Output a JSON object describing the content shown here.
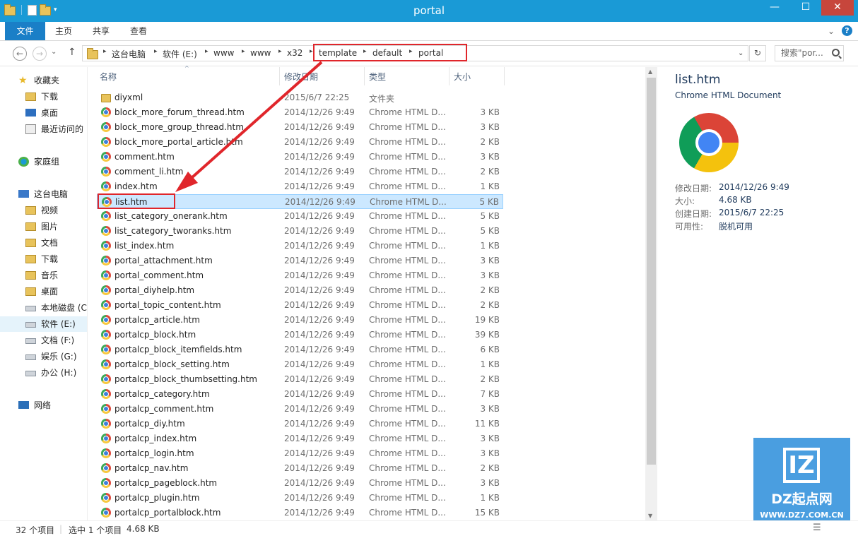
{
  "window": {
    "title": "portal"
  },
  "ribbon": {
    "tabs": [
      "文件",
      "主页",
      "共享",
      "查看"
    ],
    "help": "?"
  },
  "nav": {
    "back": "←",
    "forward": "→",
    "up": "↑",
    "breadcrumbs": [
      "这台电脑",
      "软件 (E:)",
      "www",
      "www",
      "x32",
      "template",
      "default",
      "portal"
    ],
    "search_placeholder": "搜索\"por...",
    "refresh": "↻"
  },
  "sidebar": {
    "items": [
      {
        "label": "收藏夹",
        "icon": "star-icon"
      },
      {
        "label": "下载",
        "icon": "folder-icon"
      },
      {
        "label": "桌面",
        "icon": "desktop-icon"
      },
      {
        "label": "最近访问的",
        "icon": "recent-icon"
      },
      {
        "label": "家庭组",
        "icon": "homegroup-icon"
      },
      {
        "label": "这台电脑",
        "icon": "computer-icon"
      },
      {
        "label": "视频",
        "icon": "folder-icon"
      },
      {
        "label": "图片",
        "icon": "folder-icon"
      },
      {
        "label": "文档",
        "icon": "folder-icon"
      },
      {
        "label": "下载",
        "icon": "folder-icon"
      },
      {
        "label": "音乐",
        "icon": "folder-icon"
      },
      {
        "label": "桌面",
        "icon": "folder-icon"
      },
      {
        "label": "本地磁盘 (C",
        "icon": "drive-icon"
      },
      {
        "label": "软件 (E:)",
        "icon": "drive-icon"
      },
      {
        "label": "文档 (F:)",
        "icon": "drive-icon"
      },
      {
        "label": "娱乐 (G:)",
        "icon": "drive-icon"
      },
      {
        "label": "办公 (H:)",
        "icon": "drive-icon"
      },
      {
        "label": "网络",
        "icon": "network-icon"
      }
    ]
  },
  "columns": {
    "name": "名称",
    "date": "修改日期",
    "type": "类型",
    "size": "大小"
  },
  "files": [
    {
      "name": "diyxml",
      "date": "2015/6/7 22:25",
      "type": "文件夹",
      "size": "",
      "folder": true
    },
    {
      "name": "block_more_forum_thread.htm",
      "date": "2014/12/26 9:49",
      "type": "Chrome HTML D...",
      "size": "3 KB"
    },
    {
      "name": "block_more_group_thread.htm",
      "date": "2014/12/26 9:49",
      "type": "Chrome HTML D...",
      "size": "3 KB"
    },
    {
      "name": "block_more_portal_article.htm",
      "date": "2014/12/26 9:49",
      "type": "Chrome HTML D...",
      "size": "2 KB"
    },
    {
      "name": "comment.htm",
      "date": "2014/12/26 9:49",
      "type": "Chrome HTML D...",
      "size": "3 KB"
    },
    {
      "name": "comment_li.htm",
      "date": "2014/12/26 9:49",
      "type": "Chrome HTML D...",
      "size": "2 KB"
    },
    {
      "name": "index.htm",
      "date": "2014/12/26 9:49",
      "type": "Chrome HTML D...",
      "size": "1 KB"
    },
    {
      "name": "list.htm",
      "date": "2014/12/26 9:49",
      "type": "Chrome HTML D...",
      "size": "5 KB",
      "selected": true
    },
    {
      "name": "list_category_onerank.htm",
      "date": "2014/12/26 9:49",
      "type": "Chrome HTML D...",
      "size": "5 KB"
    },
    {
      "name": "list_category_tworanks.htm",
      "date": "2014/12/26 9:49",
      "type": "Chrome HTML D...",
      "size": "5 KB"
    },
    {
      "name": "list_index.htm",
      "date": "2014/12/26 9:49",
      "type": "Chrome HTML D...",
      "size": "1 KB"
    },
    {
      "name": "portal_attachment.htm",
      "date": "2014/12/26 9:49",
      "type": "Chrome HTML D...",
      "size": "3 KB"
    },
    {
      "name": "portal_comment.htm",
      "date": "2014/12/26 9:49",
      "type": "Chrome HTML D...",
      "size": "3 KB"
    },
    {
      "name": "portal_diyhelp.htm",
      "date": "2014/12/26 9:49",
      "type": "Chrome HTML D...",
      "size": "2 KB"
    },
    {
      "name": "portal_topic_content.htm",
      "date": "2014/12/26 9:49",
      "type": "Chrome HTML D...",
      "size": "2 KB"
    },
    {
      "name": "portalcp_article.htm",
      "date": "2014/12/26 9:49",
      "type": "Chrome HTML D...",
      "size": "19 KB"
    },
    {
      "name": "portalcp_block.htm",
      "date": "2014/12/26 9:49",
      "type": "Chrome HTML D...",
      "size": "39 KB"
    },
    {
      "name": "portalcp_block_itemfields.htm",
      "date": "2014/12/26 9:49",
      "type": "Chrome HTML D...",
      "size": "6 KB"
    },
    {
      "name": "portalcp_block_setting.htm",
      "date": "2014/12/26 9:49",
      "type": "Chrome HTML D...",
      "size": "1 KB"
    },
    {
      "name": "portalcp_block_thumbsetting.htm",
      "date": "2014/12/26 9:49",
      "type": "Chrome HTML D...",
      "size": "2 KB"
    },
    {
      "name": "portalcp_category.htm",
      "date": "2014/12/26 9:49",
      "type": "Chrome HTML D...",
      "size": "7 KB"
    },
    {
      "name": "portalcp_comment.htm",
      "date": "2014/12/26 9:49",
      "type": "Chrome HTML D...",
      "size": "3 KB"
    },
    {
      "name": "portalcp_diy.htm",
      "date": "2014/12/26 9:49",
      "type": "Chrome HTML D...",
      "size": "11 KB"
    },
    {
      "name": "portalcp_index.htm",
      "date": "2014/12/26 9:49",
      "type": "Chrome HTML D...",
      "size": "3 KB"
    },
    {
      "name": "portalcp_login.htm",
      "date": "2014/12/26 9:49",
      "type": "Chrome HTML D...",
      "size": "3 KB"
    },
    {
      "name": "portalcp_nav.htm",
      "date": "2014/12/26 9:49",
      "type": "Chrome HTML D...",
      "size": "2 KB"
    },
    {
      "name": "portalcp_pageblock.htm",
      "date": "2014/12/26 9:49",
      "type": "Chrome HTML D...",
      "size": "3 KB"
    },
    {
      "name": "portalcp_plugin.htm",
      "date": "2014/12/26 9:49",
      "type": "Chrome HTML D...",
      "size": "1 KB"
    },
    {
      "name": "portalcp_portalblock.htm",
      "date": "2014/12/26 9:49",
      "type": "Chrome HTML D...",
      "size": "15 KB"
    }
  ],
  "details": {
    "title": "list.htm",
    "subtitle": "Chrome HTML Document",
    "props": [
      {
        "label": "修改日期:",
        "value": "2014/12/26 9:49"
      },
      {
        "label": "大小:",
        "value": "4.68 KB"
      },
      {
        "label": "创建日期:",
        "value": "2015/6/7 22:25"
      },
      {
        "label": "可用性:",
        "value": "脱机可用"
      }
    ]
  },
  "status": {
    "count": "32 个项目",
    "selected": "选中 1 个项目",
    "size": "4.68 KB"
  },
  "watermark": {
    "logo": "IZ",
    "name": "DZ起点网",
    "url": "WWW.DZ7.COM.CN"
  },
  "colors": {
    "titlebar": "#1a9ad6",
    "file_tab": "#1a7fc7",
    "selection": "#cce8ff",
    "annotation": "#e0262b"
  }
}
